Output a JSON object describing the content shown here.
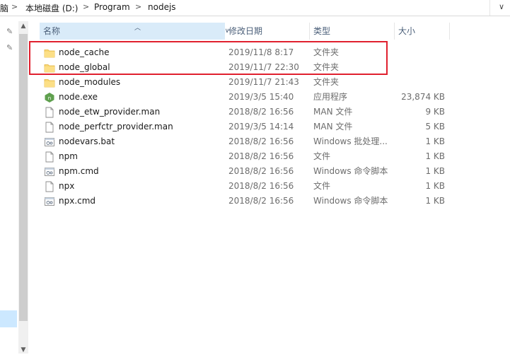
{
  "address_bar": {
    "crumbs": [
      "脑",
      "本地磁盘 (D:)",
      "Program",
      "nodejs"
    ],
    "separator": ">",
    "dropdown": "∨"
  },
  "columns": {
    "name": "名称",
    "date": "修改日期",
    "type": "类型",
    "size": "大小"
  },
  "files": [
    {
      "name": "node_cache",
      "date": "2019/11/8 8:17",
      "type": "文件夹",
      "size": "",
      "icon": "folder-icon"
    },
    {
      "name": "node_global",
      "date": "2019/11/7 22:30",
      "type": "文件夹",
      "size": "",
      "icon": "folder-icon"
    },
    {
      "name": "node_modules",
      "date": "2019/11/7 21:43",
      "type": "文件夹",
      "size": "",
      "icon": "folder-icon"
    },
    {
      "name": "node.exe",
      "date": "2019/3/5 15:40",
      "type": "应用程序",
      "size": "23,874 KB",
      "icon": "node-exe-icon"
    },
    {
      "name": "node_etw_provider.man",
      "date": "2018/8/2 16:56",
      "type": "MAN 文件",
      "size": "9 KB",
      "icon": "file-icon"
    },
    {
      "name": "node_perfctr_provider.man",
      "date": "2019/3/5 14:14",
      "type": "MAN 文件",
      "size": "5 KB",
      "icon": "file-icon"
    },
    {
      "name": "nodevars.bat",
      "date": "2018/8/2 16:56",
      "type": "Windows 批处理...",
      "size": "1 KB",
      "icon": "script-icon"
    },
    {
      "name": "npm",
      "date": "2018/8/2 16:56",
      "type": "文件",
      "size": "1 KB",
      "icon": "file-icon"
    },
    {
      "name": "npm.cmd",
      "date": "2018/8/2 16:56",
      "type": "Windows 命令脚本",
      "size": "1 KB",
      "icon": "script-icon"
    },
    {
      "name": "npx",
      "date": "2018/8/2 16:56",
      "type": "文件",
      "size": "1 KB",
      "icon": "file-icon"
    },
    {
      "name": "npx.cmd",
      "date": "2018/8/2 16:56",
      "type": "Windows 命令脚本",
      "size": "1 KB",
      "icon": "script-icon"
    }
  ],
  "colors": {
    "highlight": "#e0202e",
    "folder": "#f8d775",
    "header_selected": "#d9ebf9",
    "node_green": "#5fa04e"
  }
}
